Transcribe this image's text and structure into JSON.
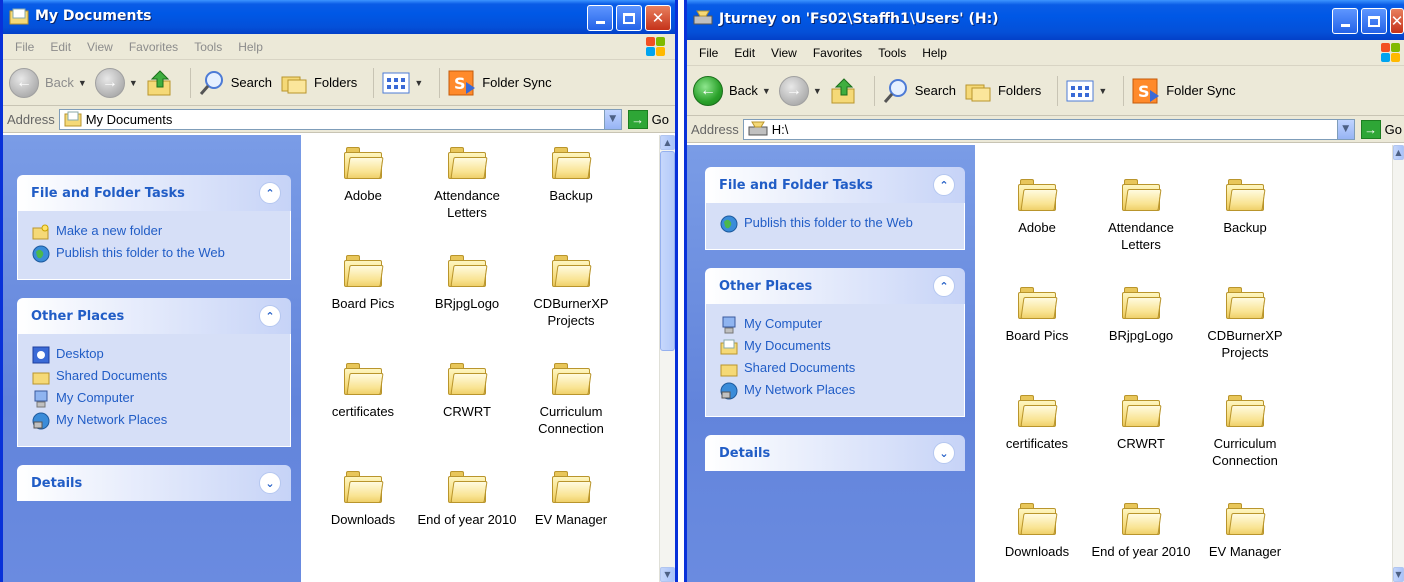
{
  "left": {
    "title": "My Documents",
    "menu": [
      "File",
      "Edit",
      "View",
      "Favorites",
      "Tools",
      "Help"
    ],
    "toolbar": {
      "back": "Back",
      "search": "Search",
      "folders": "Folders",
      "sync": "Folder Sync"
    },
    "address": {
      "label": "Address",
      "value": "My Documents",
      "go": "Go"
    },
    "panels": {
      "tasks": {
        "title": "File and Folder Tasks",
        "links": [
          "Make a new folder",
          "Publish this folder to the Web"
        ]
      },
      "places": {
        "title": "Other Places",
        "links": [
          "Desktop",
          "Shared Documents",
          "My Computer",
          "My Network Places"
        ]
      },
      "details": {
        "title": "Details"
      }
    },
    "files": [
      "Adobe",
      "Attendance Letters",
      "Backup",
      "Board Pics",
      "BRjpgLogo",
      "CDBurnerXP Projects",
      "certificates",
      "CRWRT",
      "Curriculum Connection",
      "Downloads",
      "End of year 2010",
      "EV Manager"
    ]
  },
  "right": {
    "title": "Jturney on 'Fs02\\Staffh1\\Users' (H:)",
    "menu": [
      "File",
      "Edit",
      "View",
      "Favorites",
      "Tools",
      "Help"
    ],
    "toolbar": {
      "back": "Back",
      "search": "Search",
      "folders": "Folders",
      "sync": "Folder Sync"
    },
    "address": {
      "label": "Address",
      "value": "H:\\",
      "go": "Go"
    },
    "panels": {
      "tasks": {
        "title": "File and Folder Tasks",
        "links": [
          "Publish this folder to the Web"
        ]
      },
      "places": {
        "title": "Other Places",
        "links": [
          "My Computer",
          "My Documents",
          "Shared Documents",
          "My Network Places"
        ]
      },
      "details": {
        "title": "Details"
      }
    },
    "files": [
      "Adobe",
      "Attendance Letters",
      "Backup",
      "Board Pics",
      "BRjpgLogo",
      "CDBurnerXP Projects",
      "certificates",
      "CRWRT",
      "Curriculum Connection",
      "Downloads",
      "End of year 2010",
      "EV Manager"
    ]
  },
  "colors": {
    "titlebar": "#0058e6",
    "taskpane": "#6e8fdd",
    "link": "#215dc6",
    "folder": "#f5d977"
  }
}
